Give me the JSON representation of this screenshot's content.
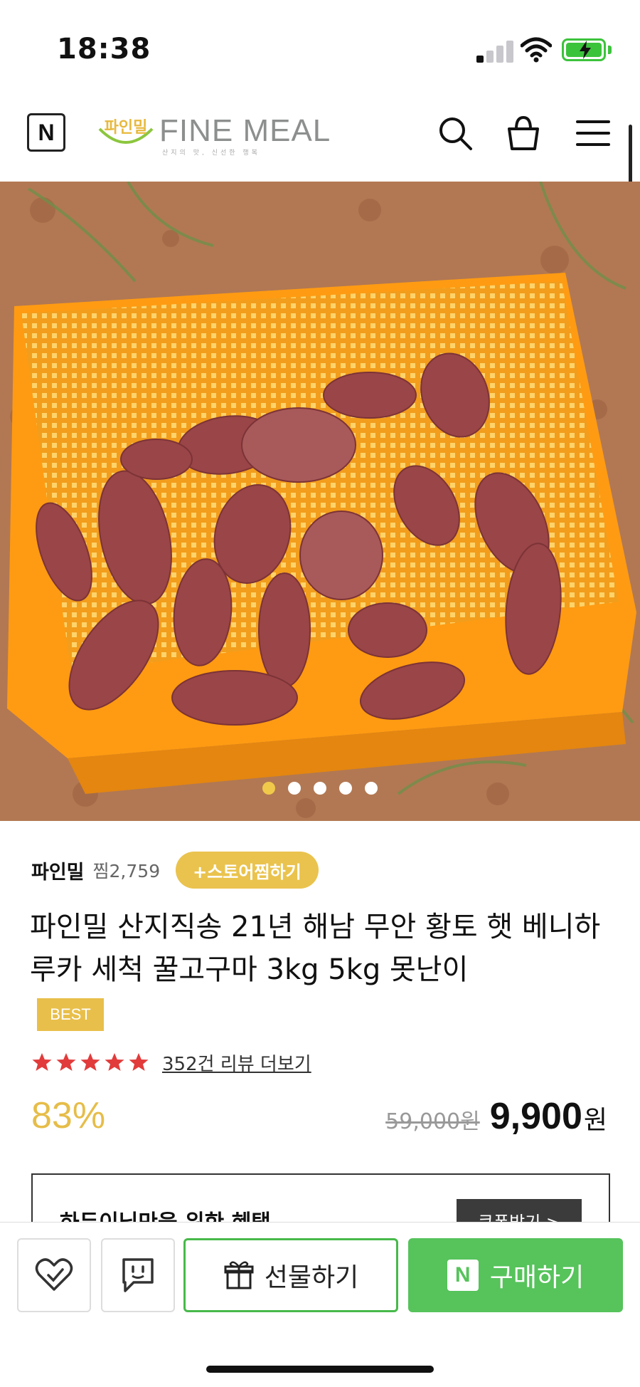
{
  "status_bar": {
    "time": "18:38"
  },
  "header": {
    "n_logo": "N",
    "brand_badge": "파인밀",
    "brand_name": "FINE MEAL",
    "brand_slogan": "산지의 맛, 신선한 행복",
    "icons": [
      "search-icon",
      "shopping-bag-icon",
      "menu-icon"
    ]
  },
  "carousel": {
    "total": 5,
    "active_index": 0
  },
  "store": {
    "name": "파인밀",
    "zzim": "찜2,759",
    "follow_label": "+스토어찜하기"
  },
  "product": {
    "title": "파인밀 산지직송 21년 해남 무안 황토 햇 베니하루카 세척 꿀고구마 3kg 5kg 못난이",
    "badge": "BEST",
    "rating_stars": 5,
    "review_link": "352건 리뷰 더보기",
    "discount": "83%",
    "original_price": "59,000원",
    "sale_price": "9,900",
    "sale_unit": "원"
  },
  "benefit": {
    "text": "하두이님만을 위한 혜택",
    "coupon_label": "쿠폰받기 >"
  },
  "bottom_bar": {
    "gift_label": "선물하기",
    "buy_n": "N",
    "buy_label": "구매하기"
  },
  "colors": {
    "accent_yellow": "#eac34e",
    "naver_green": "#56c35b",
    "star_red": "#e23b3b"
  }
}
